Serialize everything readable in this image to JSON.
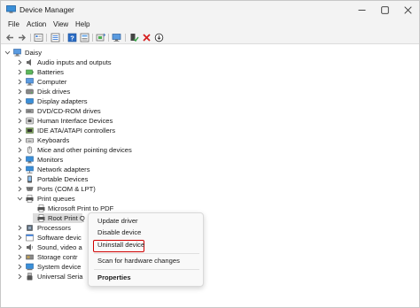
{
  "window": {
    "title": "Device Manager",
    "icon": "device-manager-icon",
    "controls": [
      "minimize-icon",
      "maximize-icon",
      "close-icon"
    ]
  },
  "menu": {
    "file": "File",
    "action": "Action",
    "view": "View",
    "help": "Help"
  },
  "toolbar": {
    "buttons": [
      "back-arrow-icon",
      "forward-arrow-icon",
      "properties-icon",
      "list-view-icon",
      "help-icon",
      "details-icon",
      "update-driver-icon",
      "scan-hardware-icon",
      "enable-device-icon",
      "uninstall-device-icon",
      "download-icon"
    ]
  },
  "tree": {
    "root": "Daisy",
    "categories": [
      {
        "label": "Audio inputs and outputs",
        "icon": "audio-icon"
      },
      {
        "label": "Batteries",
        "icon": "battery-icon"
      },
      {
        "label": "Computer",
        "icon": "computer-icon"
      },
      {
        "label": "Disk drives",
        "icon": "disk-drive-icon"
      },
      {
        "label": "Display adapters",
        "icon": "display-adapter-icon"
      },
      {
        "label": "DVD/CD-ROM drives",
        "icon": "dvd-drive-icon"
      },
      {
        "label": "Human Interface Devices",
        "icon": "hid-icon"
      },
      {
        "label": "IDE ATA/ATAPI controllers",
        "icon": "ide-controller-icon"
      },
      {
        "label": "Keyboards",
        "icon": "keyboard-icon"
      },
      {
        "label": "Mice and other pointing devices",
        "icon": "mouse-icon"
      },
      {
        "label": "Monitors",
        "icon": "monitor-icon"
      },
      {
        "label": "Network adapters",
        "icon": "network-adapter-icon"
      },
      {
        "label": "Portable Devices",
        "icon": "portable-device-icon"
      },
      {
        "label": "Ports (COM & LPT)",
        "icon": "port-icon"
      },
      {
        "label": "Print queues",
        "icon": "printer-icon",
        "expanded": true
      },
      {
        "label": "Processors",
        "icon": "processor-icon"
      },
      {
        "label": "Software devic",
        "icon": "software-device-icon"
      },
      {
        "label": "Sound, video a",
        "icon": "sound-icon"
      },
      {
        "label": "Storage contr",
        "icon": "storage-controller-icon"
      },
      {
        "label": "System device",
        "icon": "system-device-icon"
      },
      {
        "label": "Universal Seria",
        "icon": "usb-icon"
      }
    ],
    "print_queue_children": [
      {
        "label": "Microsoft Print to PDF",
        "icon": "printer-icon"
      },
      {
        "label": "Root Print Q",
        "icon": "printer-icon",
        "selected": true
      }
    ]
  },
  "context_menu": {
    "update_driver": "Update driver",
    "disable_device": "Disable device",
    "uninstall_device": "Uninstall device",
    "scan_hardware": "Scan for hardware changes",
    "properties": "Properties",
    "highlight_color": "#d00000"
  }
}
